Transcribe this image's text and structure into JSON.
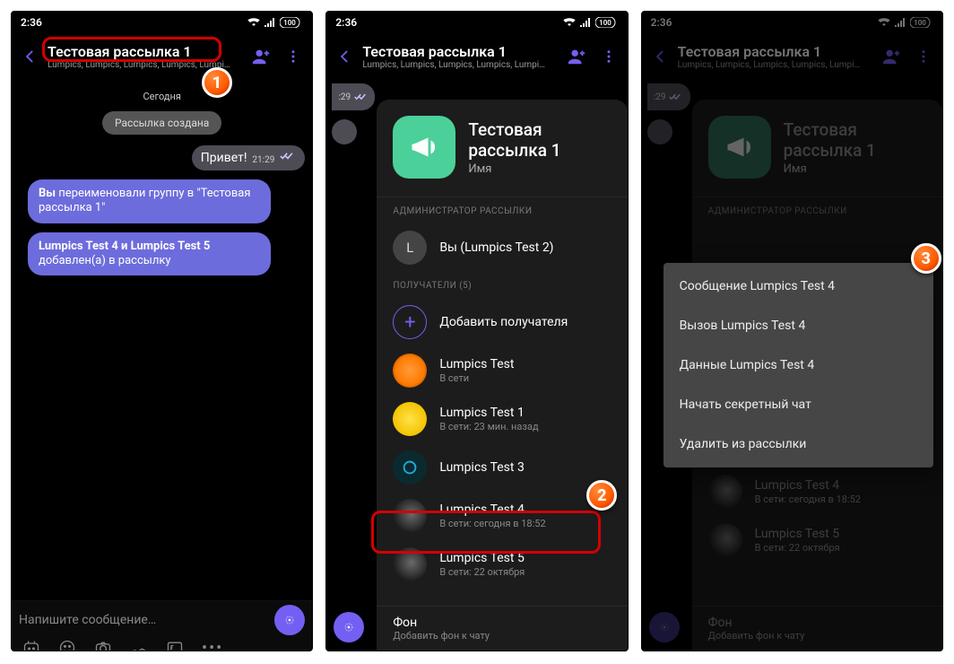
{
  "status": {
    "time": "2:36",
    "battery": "100"
  },
  "header": {
    "title": "Тестовая рассылка 1",
    "subtitle": "Lumpics, Lumpics, Lumpics, Lumpics, Lumpi…"
  },
  "chat": {
    "day": "Сегодня",
    "created_chip": "Рассылка создана",
    "msg_out": {
      "text": "Привет!",
      "ts": "21:29"
    },
    "sys1_prefix": "Вы",
    "sys1_rest": " переименовали группу в \"Тестовая рассылка 1\"",
    "sys2_bold": "Lumpics Test 4 и Lumpics Test 5",
    "sys2_rest": " добавлен(а) в рассылку",
    "edge_ts": ":29"
  },
  "input": {
    "placeholder": "Напишите сообщение…"
  },
  "sheet": {
    "title": "Тестовая\nрассылка 1",
    "title_line1": "Тестовая",
    "title_line2": "рассылка 1",
    "subtitle": "Имя",
    "admin_h": "АДМИНИСТРАТОР РАССЫЛКИ",
    "admin": {
      "initial": "L",
      "name": "Вы (Lumpics Test 2)"
    },
    "rec_h": "ПОЛУЧАТЕЛИ (5)",
    "add": "Добавить получателя",
    "items": [
      {
        "name": "Lumpics Test",
        "status": "В сети"
      },
      {
        "name": "Lumpics Test 1",
        "status": "В сети: 23 мин. назад"
      },
      {
        "name": "Lumpics Test 3",
        "status": ""
      },
      {
        "name": "Lumpics Test 4",
        "status": "В сети: сегодня в 18:52"
      },
      {
        "name": "Lumpics Test 5",
        "status": "В сети: 22 октября"
      }
    ],
    "bg_title": "Фон",
    "bg_sub": "Добавить фон к чату"
  },
  "ctx": {
    "items": [
      "Сообщение Lumpics Test 4",
      "Вызов Lumpics Test 4",
      "Данные Lumpics Test 4",
      "Начать секретный чат",
      "Удалить из рассылки"
    ]
  },
  "markers": {
    "m1": "1",
    "m2": "2",
    "m3": "3"
  }
}
